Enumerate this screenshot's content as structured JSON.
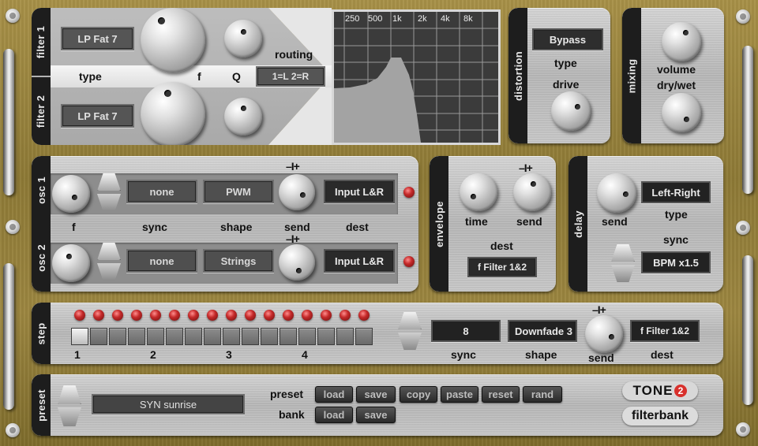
{
  "filter": {
    "tab1": "filter 1",
    "tab2": "filter 2",
    "filter1_type": "LP Fat 7",
    "filter2_type": "LP Fat 7",
    "type_label": "type",
    "f_label": "f",
    "q_label": "Q",
    "routing_label": "routing",
    "routing_value": "1=L 2=R"
  },
  "spectrum": {
    "freq_labels": [
      "250",
      "500",
      "1k",
      "2k",
      "4k",
      "8k"
    ]
  },
  "distortion": {
    "tab": "distortion",
    "type_value": "Bypass",
    "type_label": "type",
    "drive_label": "drive"
  },
  "mixing": {
    "tab": "mixing",
    "volume_label": "volume",
    "drywet_label": "dry/wet"
  },
  "osc": {
    "tab1": "osc 1",
    "tab2": "osc 2",
    "f_label": "f",
    "sync_label": "sync",
    "shape_label": "shape",
    "send_label": "send",
    "dest_label": "dest",
    "pm_label": "–I+",
    "osc1_sync": "none",
    "osc1_shape": "PWM",
    "osc1_dest": "Input L&R",
    "osc2_sync": "none",
    "osc2_shape": "Strings",
    "osc2_dest": "Input L&R"
  },
  "envelope": {
    "tab": "envelope",
    "time_label": "time",
    "send_label": "send",
    "pm_label": "–I+",
    "dest_label": "dest",
    "dest_value": "f Filter 1&2"
  },
  "delay": {
    "tab": "delay",
    "send_label": "send",
    "type_value": "Left-Right",
    "type_label": "type",
    "sync_label": "sync",
    "sync_value": "BPM x1.5"
  },
  "step": {
    "tab": "step",
    "beat_labels": [
      "1",
      "2",
      "3",
      "4"
    ],
    "active_step": 1,
    "step_count": 16,
    "sync_value": "8",
    "sync_label": "sync",
    "shape_value": "Downfade 3",
    "shape_label": "shape",
    "pm_label": "–I+",
    "send_label": "send",
    "dest_value": "f Filter 1&2",
    "dest_label": "dest"
  },
  "preset": {
    "tab": "preset",
    "name": "SYN sunrise",
    "preset_label": "preset",
    "bank_label": "bank",
    "preset_load": "load",
    "preset_save": "save",
    "copy": "copy",
    "paste": "paste",
    "reset": "reset",
    "rand": "rand",
    "bank_load": "load",
    "bank_save": "save"
  },
  "brand": {
    "logo": "TONE2",
    "product": "filterbank",
    "accent_color": "#d8302c"
  }
}
